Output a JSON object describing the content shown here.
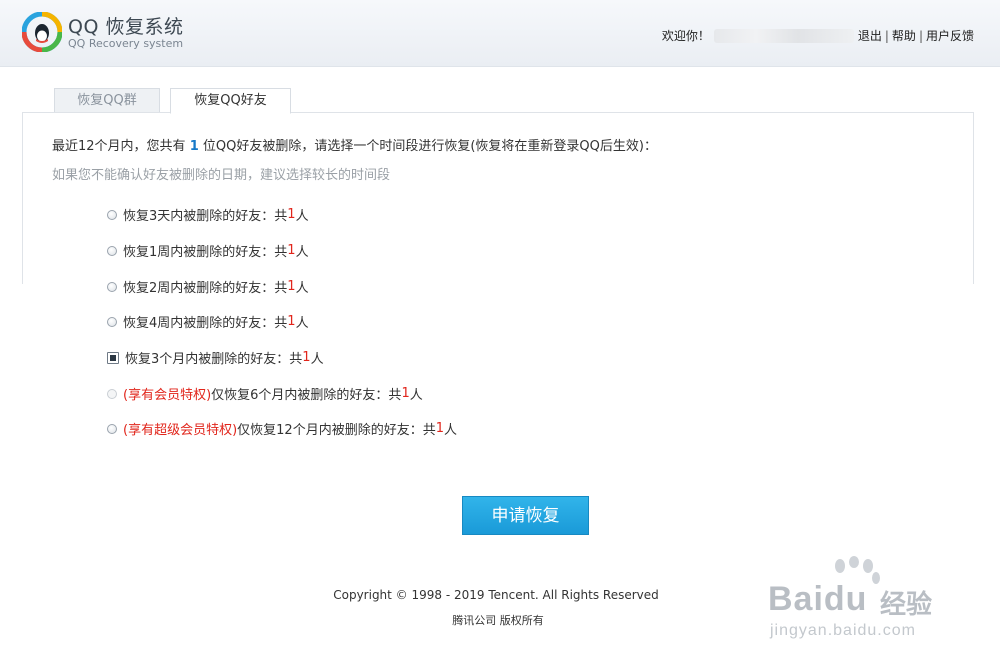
{
  "header": {
    "logo_title": "QQ 恢复系统",
    "logo_subtitle": "QQ Recovery system",
    "welcome": "欢迎你！",
    "logout": "退出",
    "help": "帮助",
    "feedback": "用户反馈",
    "separator": "|"
  },
  "tabs": [
    {
      "label": "恢复QQ群",
      "active": false
    },
    {
      "label": "恢复QQ好友",
      "active": true
    }
  ],
  "intro": {
    "prefix": "最近12个月内，您共有 ",
    "count": "1",
    "suffix": " 位QQ好友被删除，请选择一个时间段进行恢复(恢复将在重新登录QQ后生效)：",
    "hint": "如果您不能确认好友被删除的日期，建议选择较长的时间段"
  },
  "options": [
    {
      "vip": "",
      "label": "恢复3天内被删除的好友：共 ",
      "count": "1",
      "unit": " 人",
      "selected": false
    },
    {
      "vip": "",
      "label": "恢复1周内被删除的好友：共 ",
      "count": "1",
      "unit": " 人",
      "selected": false
    },
    {
      "vip": "",
      "label": "恢复2周内被删除的好友：共 ",
      "count": "1",
      "unit": " 人",
      "selected": false
    },
    {
      "vip": "",
      "label": "恢复4周内被删除的好友：共 ",
      "count": "1",
      "unit": " 人",
      "selected": false
    },
    {
      "vip": "",
      "label": "恢复3个月内被删除的好友：共 ",
      "count": "1",
      "unit": " 人",
      "selected": true
    },
    {
      "vip": "(享有会员特权)",
      "label": "仅恢复6个月内被删除的好友：共 ",
      "count": "1",
      "unit": " 人",
      "selected": false
    },
    {
      "vip": "(享有超级会员特权)",
      "label": "仅恢复12个月内被删除的好友：共 ",
      "count": "1",
      "unit": " 人",
      "selected": false
    }
  ],
  "apply_button": "申请恢复",
  "footer": {
    "copyright": "Copyright © 1998 - 2019 Tencent. All Rights Reserved",
    "company": "腾讯公司 版权所有"
  },
  "watermark": {
    "brand": "Baidu",
    "cn": "经验",
    "url": "jingyan.baidu.com"
  },
  "colors": {
    "accent_blue": "#1a9ad8",
    "count_red": "#e1251b",
    "intro_blue": "#1679c8"
  }
}
